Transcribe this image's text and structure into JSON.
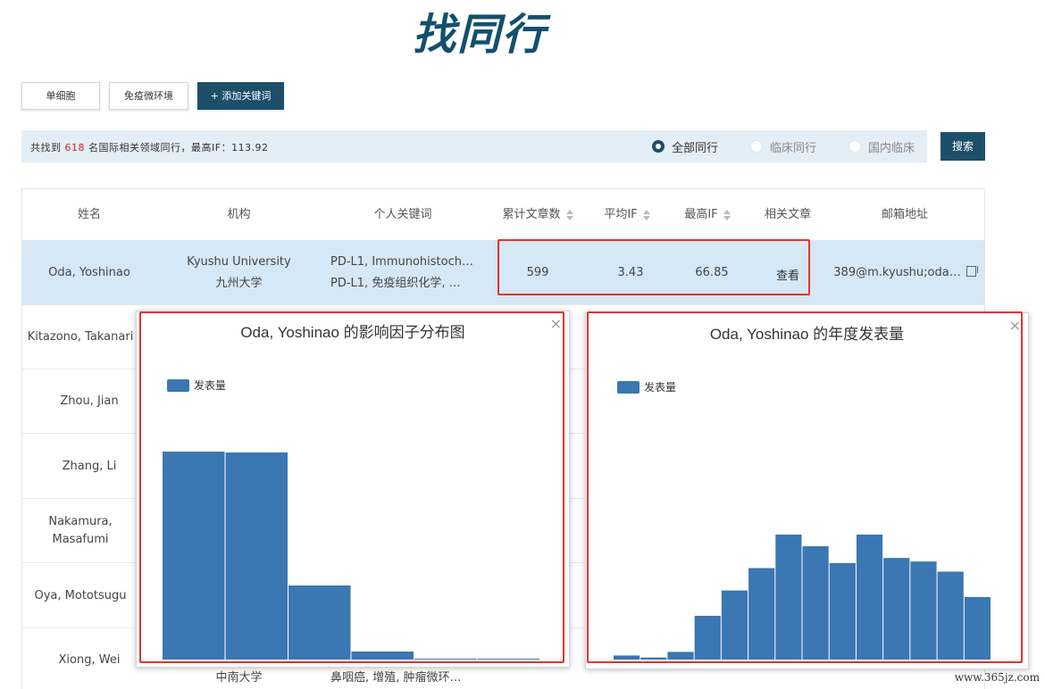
{
  "logo": {
    "text": "找同行"
  },
  "keywords": [
    {
      "label": "单细胞"
    },
    {
      "label": "免疫微环境"
    }
  ],
  "add_keyword_label": "+ 添加关键词",
  "summary": {
    "prefix": "共找到",
    "count": "618",
    "suffix": "名国际相关领域同行，最高IF：113.92"
  },
  "filters": [
    {
      "label": "全部同行",
      "selected": true
    },
    {
      "label": "临床同行",
      "selected": false
    },
    {
      "label": "国内临床",
      "selected": false
    }
  ],
  "search_label": "搜索",
  "table": {
    "headers": {
      "name": "姓名",
      "institution": "机构",
      "keywords": "个人关键词",
      "articles": "累计文章数",
      "avg_if": "平均IF",
      "max_if": "最高IF",
      "related": "相关文章",
      "email": "邮箱地址"
    },
    "first_row": {
      "name": "Oda, Yoshinao",
      "institution_en": "Kyushu University",
      "institution_cn": "九州大学",
      "keywords_en": "PD-L1, Immunohistoch…",
      "keywords_cn": "PD-L1, 免疫组织化学, …",
      "articles": "599",
      "avg_if": "3.43",
      "max_if": "66.85",
      "related": "查看",
      "email": "389@m.kyushu;oda…"
    },
    "other_names": [
      "Kitazono, Takanari",
      "Zhou, Jian",
      "Zhang, Li",
      "Nakamura, Masafumi",
      "Oya, Mototsugu",
      "Xiong, Wei"
    ],
    "last_row_institution_partial": "中南大学",
    "last_row_keywords_partial": "鼻咽癌, 增殖, 肿瘤微环…"
  },
  "if_chart": {
    "title": "Oda, Yoshinao 的影响因子分布图",
    "close": "×",
    "chart_data": {
      "type": "bar",
      "series": [
        {
          "name": "发表量",
          "values": [
            233,
            232,
            83,
            9,
            1,
            1
          ]
        }
      ],
      "ylim": [
        0,
        240
      ],
      "color": "#3a77b3"
    }
  },
  "year_chart": {
    "title": "Oda, Yoshinao 的年度发表量",
    "close": "×",
    "chart_data": {
      "type": "bar",
      "series": [
        {
          "name": "发表量",
          "values": [
            8,
            4,
            15,
            86,
            136,
            180,
            246,
            223,
            190,
            246,
            200,
            193,
            173,
            123
          ]
        }
      ],
      "ylim": [
        0,
        260
      ],
      "color": "#3a77b3"
    }
  },
  "watermark": "www.365jz.com"
}
